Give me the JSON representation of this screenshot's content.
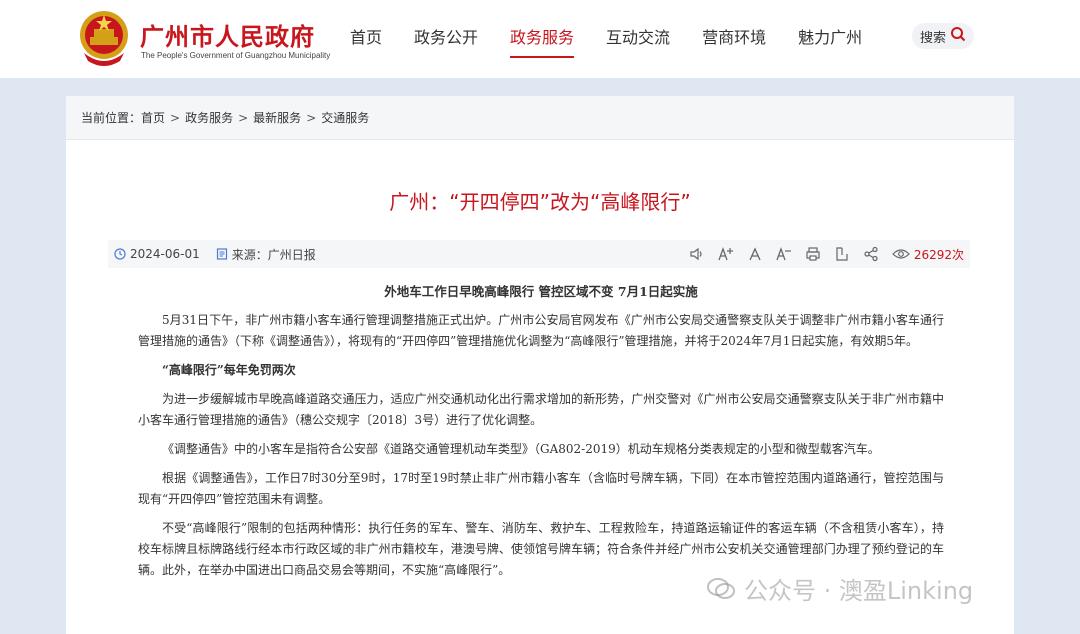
{
  "header": {
    "logo_cn": "广州市人民政府",
    "logo_en": "The People's Government of Guangzhou Municipality",
    "nav": [
      "首页",
      "政务公开",
      "政务服务",
      "互动交流",
      "营商环境",
      "魅力广州"
    ],
    "active_nav": "政务服务",
    "search_label": "搜索",
    "brand_color": "#c8161d"
  },
  "breadcrumb": {
    "prefix": "当前位置：",
    "items": [
      "首页",
      "政务服务",
      "最新服务",
      "交通服务"
    ],
    "separator": ">"
  },
  "article": {
    "title": "广州：“开四停四”改为“高峰限行”",
    "date": "2024-06-01",
    "source": "来源：广州日报",
    "views": "26292次",
    "subhead": "外地车工作日早晚高峰限行 管控区域不变 7月1日起实施",
    "paragraphs": [
      "5月31日下午，非广州市籍小客车通行管理调整措施正式出炉。广州市公安局官网发布《广州市公安局交通警察支队关于调整非广州市籍小客车通行管理措施的通告》（下称《调整通告》），将现有的“开四停四”管理措施优化调整为“高峰限行”管理措施，并将于2024年7月1日起实施，有效期5年。",
      "“高峰限行”每年免罚两次",
      "为进一步缓解城市早晚高峰道路交通压力，适应广州交通机动化出行需求增加的新形势，广州交警对《广州市公安局交通警察支队关于非广州市籍中小客车通行管理措施的通告》（穗公交规字〔2018〕3号）进行了优化调整。",
      "《调整通告》中的小客车是指符合公安部《道路交通管理机动车类型》（GA802-2019）机动车规格分类表规定的小型和微型载客汽车。",
      "根据《调整通告》，工作日7时30分至9时，17时至19时禁止非广州市籍小客车（含临时号牌车辆，下同）在本市管控范围内道路通行，管控范围与现有“开四停四”管控范围未有调整。",
      "不受“高峰限行”限制的包括两种情形：执行任务的军车、警车、消防车、救护车、工程救险车，持道路运输证件的客运车辆（不含租赁小客车），持校车标牌且标牌路线行经本市行政区域的非广州市籍校车，港澳号牌、使领馆号牌车辆；符合条件并经广州市公安机关交通管理部门办理了预约登记的车辆。此外，在举办中国进出口商品交易会等期间，不实施“高峰限行”。"
    ]
  },
  "toolbar_icons": [
    "speaker-icon",
    "font-increase-icon",
    "font-reset-icon",
    "font-decrease-icon",
    "print-icon",
    "share-out-icon",
    "share-icon",
    "eye-icon"
  ],
  "watermark": "公众号 · 澳盈Linking"
}
